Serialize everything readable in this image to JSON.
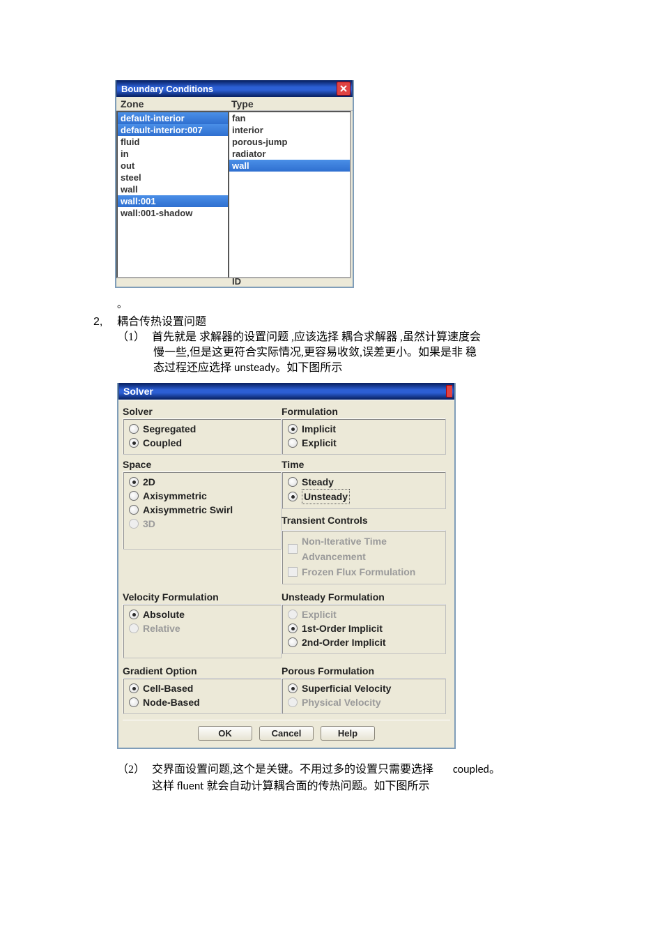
{
  "bc": {
    "title": "Boundary Conditions",
    "header_zone": "Zone",
    "header_type": "Type",
    "zone_items": [
      {
        "label": "default-interior",
        "sel": true
      },
      {
        "label": "default-interior:007",
        "sel": true
      },
      {
        "label": "fluid",
        "sel": false
      },
      {
        "label": "in",
        "sel": false
      },
      {
        "label": "out",
        "sel": false
      },
      {
        "label": "steel",
        "sel": false
      },
      {
        "label": "wall",
        "sel": false
      },
      {
        "label": "wall:001",
        "sel": true
      },
      {
        "label": "wall:001-shadow",
        "sel": false
      }
    ],
    "type_items": [
      {
        "label": "fan",
        "sel": false
      },
      {
        "label": "interior",
        "sel": false
      },
      {
        "label": "porous-jump",
        "sel": false
      },
      {
        "label": "radiator",
        "sel": false
      },
      {
        "label": "wall",
        "sel": true
      }
    ],
    "id": "ID"
  },
  "text": {
    "dot": "。",
    "h2_num": "2,",
    "h2_title": "耦合传热设置问题",
    "p1_num": "（1）",
    "p1_l1": "首先就是 求解器的设置问题 ,应该选择 耦合求解器 ,虽然计算速度会",
    "p1_l2": "慢一些,但是这更符合实际情况,更容易收敛,误差更小。如果是非 稳",
    "p1_l3_a": "态过程还应选择 ",
    "p1_l3_b": "unsteady",
    "p1_l3_c": "。如下图所示",
    "p2_num": "（2）",
    "p2_l1_a": "交界面设置问题,这个是关键。不用过多的设置只需要选择",
    "p2_l1_b": "coupled。",
    "p2_l2_a": "这样 ",
    "p2_l2_b": "fluent",
    "p2_l2_c": " 就会自动计算耦合面的传热问题。如下图所示"
  },
  "solver": {
    "title": "Solver",
    "groups": {
      "solver": {
        "title": "Solver",
        "options": [
          {
            "label": "Segregated",
            "sel": false,
            "disabled": false
          },
          {
            "label": "Coupled",
            "sel": true,
            "disabled": false
          }
        ]
      },
      "formulation": {
        "title": "Formulation",
        "options": [
          {
            "label": "Implicit",
            "sel": true,
            "disabled": false
          },
          {
            "label": "Explicit",
            "sel": false,
            "disabled": false
          }
        ]
      },
      "space": {
        "title": "Space",
        "options": [
          {
            "label": "2D",
            "sel": true,
            "disabled": false
          },
          {
            "label": "Axisymmetric",
            "sel": false,
            "disabled": false
          },
          {
            "label": "Axisymmetric Swirl",
            "sel": false,
            "disabled": false
          },
          {
            "label": "3D",
            "sel": false,
            "disabled": true
          }
        ]
      },
      "time": {
        "title": "Time",
        "options": [
          {
            "label": "Steady",
            "sel": false,
            "disabled": false
          },
          {
            "label": "Unsteady",
            "sel": true,
            "disabled": false,
            "dashed": true
          }
        ]
      },
      "transient": {
        "title": "Transient Controls",
        "checks": [
          {
            "label": "Non-Iterative Time Advancement",
            "disabled": true
          },
          {
            "label": "Frozen Flux Formulation",
            "disabled": true
          }
        ]
      },
      "velocity": {
        "title": "Velocity Formulation",
        "options": [
          {
            "label": "Absolute",
            "sel": true,
            "disabled": false
          },
          {
            "label": "Relative",
            "sel": false,
            "disabled": true
          }
        ]
      },
      "unsteady": {
        "title": "Unsteady Formulation",
        "options": [
          {
            "label": "Explicit",
            "sel": false,
            "disabled": true
          },
          {
            "label": "1st-Order Implicit",
            "sel": true,
            "disabled": false
          },
          {
            "label": "2nd-Order Implicit",
            "sel": false,
            "disabled": false
          }
        ]
      },
      "gradient": {
        "title": "Gradient Option",
        "options": [
          {
            "label": "Cell-Based",
            "sel": true,
            "disabled": false
          },
          {
            "label": "Node-Based",
            "sel": false,
            "disabled": false
          }
        ]
      },
      "porous": {
        "title": "Porous Formulation",
        "options": [
          {
            "label": "Superficial Velocity",
            "sel": true,
            "disabled": false
          },
          {
            "label": "Physical Velocity",
            "sel": false,
            "disabled": true
          }
        ]
      }
    },
    "buttons": {
      "ok": "OK",
      "cancel": "Cancel",
      "help": "Help"
    }
  }
}
